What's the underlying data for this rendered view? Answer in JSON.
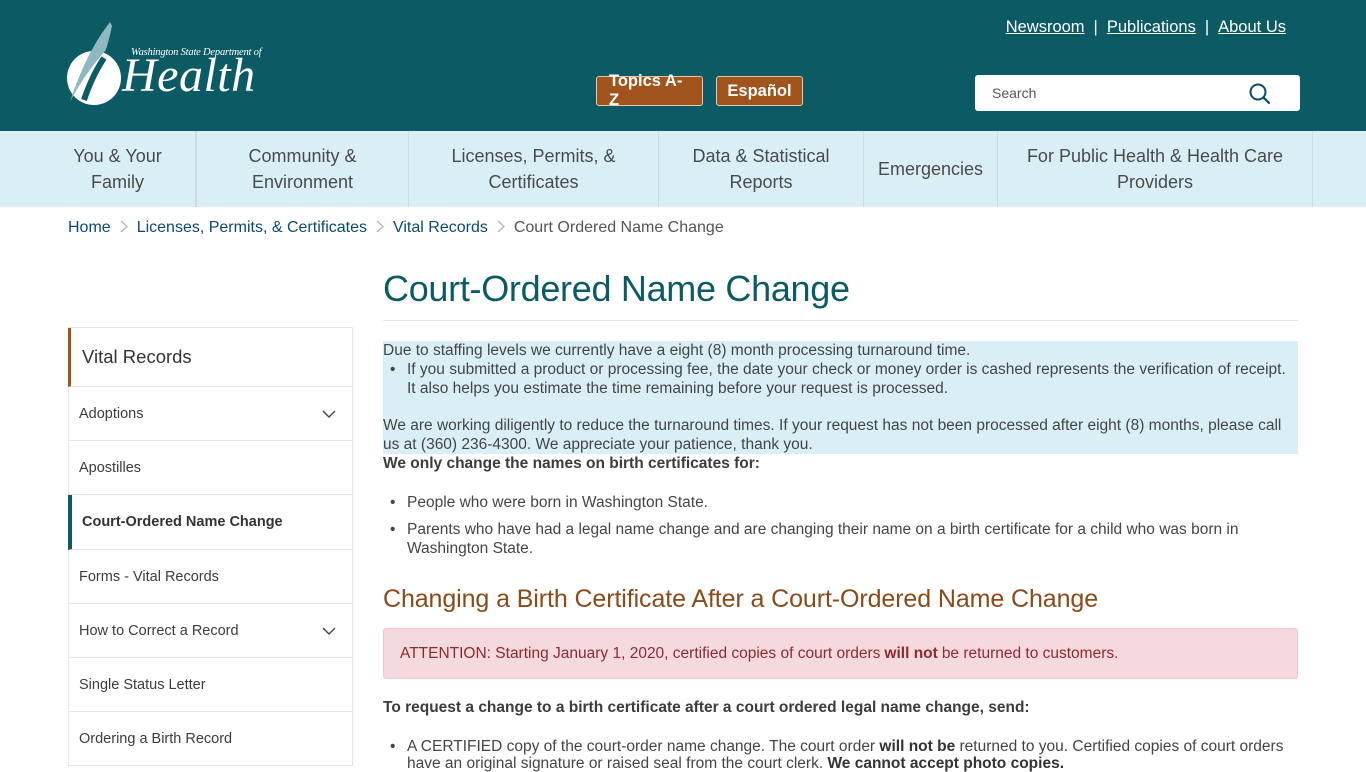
{
  "header": {
    "logo": {
      "small_text": "Washington State Department of",
      "big_text": "Health"
    },
    "util_links": [
      {
        "label": "Newsroom"
      },
      {
        "label": "Publications"
      },
      {
        "label": "About Us"
      }
    ],
    "separator": "|",
    "buttons": {
      "topics": "Topics A-Z",
      "espanol": "Español"
    },
    "search": {
      "placeholder": "Search",
      "icon": "search-icon"
    },
    "colors": {
      "header_bg": "#0b5a64",
      "button_bg": "#a0531b",
      "nav_bg": "#daeff5"
    }
  },
  "main_nav": [
    {
      "label": "You & Your Family"
    },
    {
      "label": "Community & Environment"
    },
    {
      "label": "Licenses, Permits, & Certificates"
    },
    {
      "label": "Data & Statistical Reports"
    },
    {
      "label": "Emergencies"
    },
    {
      "label": "For Public Health & Health Care Providers"
    }
  ],
  "breadcrumb": {
    "items": [
      {
        "label": "Home"
      },
      {
        "label": "Licenses, Permits, & Certificates"
      },
      {
        "label": "Vital Records"
      }
    ],
    "current": "Court Ordered Name Change",
    "separator_icon": "chevron-right-icon"
  },
  "sidebar": {
    "heading": "Vital Records",
    "items": [
      {
        "label": "Adoptions",
        "expandable": true
      },
      {
        "label": "Apostilles",
        "expandable": false
      },
      {
        "label": "Court-Ordered Name Change",
        "expandable": false,
        "active": true
      },
      {
        "label": "Forms - Vital Records",
        "expandable": false
      },
      {
        "label": "How to Correct a Record",
        "expandable": true
      },
      {
        "label": "Single Status Letter",
        "expandable": false
      },
      {
        "label": "Ordering a Birth Record",
        "expandable": false
      }
    ]
  },
  "content": {
    "title": "Court-Ordered Name Change",
    "notice": {
      "intro": "Due to staffing levels we currently have a eight (8) month processing turnaround time.",
      "bullet": "If you submitted a product or processing fee, the date your check or money order is cashed represents the verification of receipt. It also helps you estimate the time remaining before your request is processed.",
      "followup": "We are working diligently to reduce the turnaround times. If your request has not been processed after eight (8) months, please call us at (360) 236-4300. We appreciate your patience, thank you."
    },
    "eligibility": {
      "lead": "We only change the names on birth certificates for:",
      "items": [
        "People who were born in Washington State.",
        "Parents who have had a legal name change and are changing their name on a birth certificate for a child who was born in Washington State."
      ]
    },
    "section_heading": "Changing a Birth Certificate After a Court-Ordered Name Change",
    "alert": {
      "before": "ATTENTION: Starting January 1, 2020, certified copies of court orders",
      "bold": "will not",
      "after": "be returned to customers."
    },
    "request": {
      "lead": "To request a change to a birth certificate after a court ordered legal name change, send:",
      "item1": {
        "part1": "A CERTIFIED copy of the court-order name change. The court order",
        "bold1": "will not be",
        "part2": "returned to you. Certified copies of court orders have an original signature or raised seal from the court clerk.",
        "bold2": "We cannot accept photo copies."
      }
    }
  }
}
